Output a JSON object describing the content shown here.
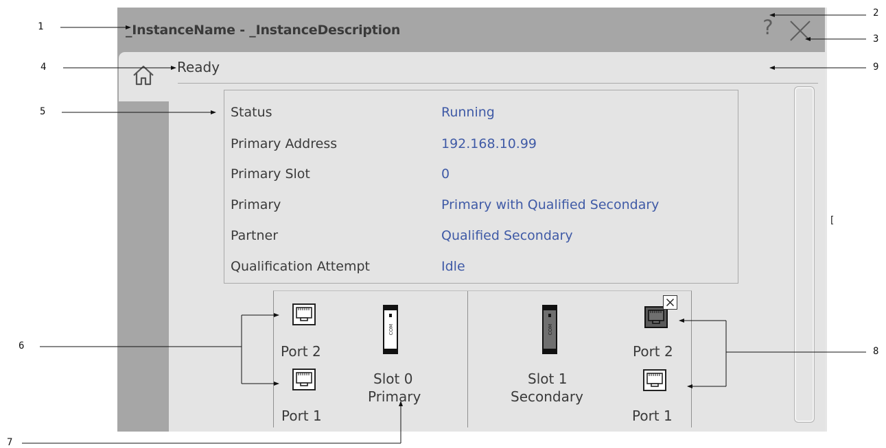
{
  "window": {
    "title": "_InstanceName - _InstanceDescription",
    "help_glyph": "?",
    "close_icon": "close-icon",
    "frame_color": "#a6a6a6",
    "panel_color": "#e4e4e4"
  },
  "header": {
    "home_icon": "home-icon",
    "status_text": "Ready"
  },
  "info": {
    "rows": [
      {
        "label": "Status",
        "value": "Running"
      },
      {
        "label": "Primary Address",
        "value": "192.168.10.99"
      },
      {
        "label": "Primary Slot",
        "value": "0"
      },
      {
        "label": "Primary",
        "value": "Primary with Qualified Secondary"
      },
      {
        "label": "Partner",
        "value": "Qualified Secondary"
      },
      {
        "label": "Qualification Attempt",
        "value": "Idle"
      }
    ],
    "value_color": "#3f5aa6"
  },
  "chassis": {
    "slot0": {
      "port2_label": "Port 2",
      "port1_label": "Port 1",
      "slot_label_line1": "Slot 0",
      "slot_label_line2": "Primary",
      "module_text": "COM"
    },
    "slot1": {
      "port2_label": "Port 2",
      "port1_label": "Port 1",
      "slot_label_line1": "Slot 1",
      "slot_label_line2": "Secondary",
      "module_text": "COM"
    }
  },
  "callouts": {
    "c1": "1",
    "c2": "2",
    "c3": "3",
    "c4": "4",
    "c5": "5",
    "c6": "6",
    "c7": "7",
    "c8": "8",
    "c9": "9"
  }
}
